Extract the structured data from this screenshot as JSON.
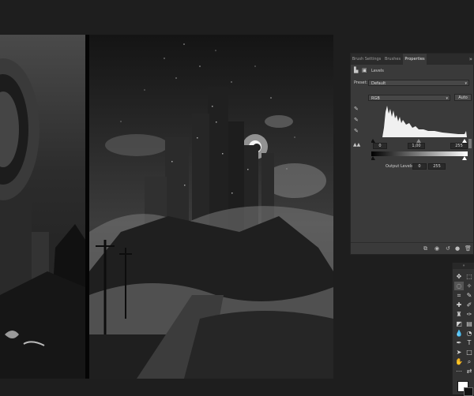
{
  "properties_panel": {
    "tabs": [
      "Brush Settings",
      "Brushes",
      "Properties"
    ],
    "active_tab": "Properties",
    "collapse_glyph": "»",
    "adjustment_title": "Levels",
    "preset_label": "Preset:",
    "preset_value": "Default",
    "channel_value": "RGB",
    "auto_label": "Auto",
    "input_black": "0",
    "input_gamma": "1,00",
    "input_white": "255",
    "output_label": "Output Levels:",
    "output_black": "0",
    "output_white": "255",
    "icons": {
      "adjustment": "levels-icon",
      "mask": "mask-icon",
      "eyedroppers": [
        "black-point-eyedropper-icon",
        "gray-point-eyedropper-icon",
        "white-point-eyedropper-icon"
      ],
      "clipping_warning": "clipping-warning-icon",
      "footer": [
        "clip-to-layer-icon",
        "view-previous-state-icon",
        "reset-icon",
        "visibility-icon",
        "delete-icon"
      ]
    }
  },
  "tools_panel": {
    "collapse_glyph": "»",
    "tools": [
      "move-tool-icon",
      "artboard-tool-icon",
      "lasso-tool-icon",
      "quick-select-tool-icon",
      "crop-tool-icon",
      "eyedropper-tool-icon",
      "spot-healing-tool-icon",
      "brush-tool-icon",
      "clone-stamp-tool-icon",
      "history-brush-tool-icon",
      "eraser-tool-icon",
      "gradient-tool-icon",
      "blur-tool-icon",
      "dodge-tool-icon",
      "pen-tool-icon",
      "type-tool-icon",
      "path-selection-tool-icon",
      "rectangle-tool-icon",
      "hand-tool-icon",
      "zoom-tool-icon",
      "edit-toolbar-icon",
      "swap-colors-icon"
    ]
  },
  "colors": {
    "app_background": "#1e1e1e",
    "panel_background": "#3a3a3a",
    "panel_tab_bar": "#2b2b2b",
    "foreground_swatch": "#ffffff"
  }
}
